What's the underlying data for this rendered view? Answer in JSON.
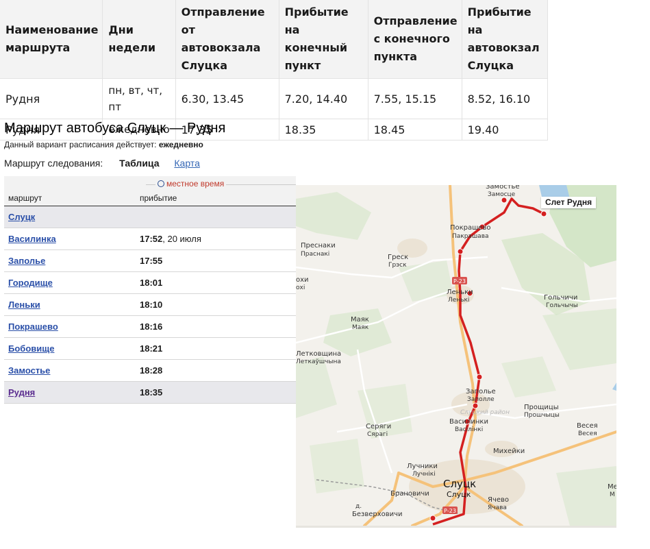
{
  "schedule": {
    "headers": [
      "Наименование маршрута",
      "Дни недели",
      "Отправление от автовокзала Слуцка",
      "Прибытие на конечный пункт",
      "Отправление с конечного пункта",
      "Прибытие на автовокзал Слуцка"
    ],
    "rows": [
      [
        "Рудня",
        "пн, вт, чт, пт",
        "6.30, 13.45",
        "7.20, 14.40",
        "7.55, 15.15",
        "8.52, 16.10"
      ],
      [
        "Рудня",
        "ежедневно",
        "17.35",
        "18.35",
        "18.45",
        "19.40"
      ]
    ]
  },
  "route": {
    "title": "Маршрут автобуса Слуцк — Рудня",
    "validity_prefix": "Данный вариант расписания действует:",
    "validity_value": "ежедневно",
    "view_label": "Маршрут следования:",
    "view_active": "Таблица",
    "view_link": "Карта"
  },
  "stops_table": {
    "timezone": "местное время",
    "col_route": "маршрут",
    "col_arrival": "прибытие",
    "stops": [
      {
        "name": "Слуцк",
        "time": "",
        "date": ""
      },
      {
        "name": "Василинка",
        "time": "17:52",
        "date": ", 20 июля"
      },
      {
        "name": "Заполье",
        "time": "17:55",
        "date": ""
      },
      {
        "name": "Городище",
        "time": "18:01",
        "date": ""
      },
      {
        "name": "Леньки",
        "time": "18:10",
        "date": ""
      },
      {
        "name": "Покрашево",
        "time": "18:16",
        "date": ""
      },
      {
        "name": "Бобовище",
        "time": "18:21",
        "date": ""
      },
      {
        "name": "Замостье",
        "time": "18:28",
        "date": ""
      },
      {
        "name": "Рудня",
        "time": "18:35",
        "date": ""
      }
    ]
  },
  "map": {
    "tooltip": "Слет Рудня",
    "road_badge": "Р-23",
    "labels": {
      "zamostye": "Замостье",
      "zamostye_by": "Замосце",
      "pokrashevo": "Покрашево",
      "pokrashevo_by": "Пакрашава",
      "presnaki": "Преснаки",
      "presnaki_by": "Праснакі",
      "gresk": "Греск",
      "gresk_by": "Грэск",
      "lenki": "Леньки",
      "lenki_by": "Ленькі",
      "golchichi": "Гольчичи",
      "golchichi_by": "Гольчычы",
      "mayak": "Маяк",
      "mayak_by": "Маяк",
      "letkovshchina": "Летковщина",
      "letkovshchina_by": "Леткаўшчына",
      "zapolye": "Заполье",
      "zapolye_by": "Заполле",
      "district": "Слуцкий район",
      "proshchitsy": "Прощицы",
      "proshchitsy_by": "Прошчыцы",
      "vesya": "Весея",
      "vesya_by": "Весея",
      "vasilinki": "Василинки",
      "vasilinki_by": "Васілінкі",
      "seryagi": "Серяги",
      "seryagi_by": "Сярагі",
      "mikheyki": "Михейки",
      "luchniki": "Лучники",
      "luchniki_by": "Лучнікі",
      "slutsk": "Слуцк",
      "slutsk_by": "Слуцк",
      "branovichi": "Брановичи",
      "yachevo": "Ячево",
      "yachevo_by": "Ячава",
      "bezverkhovichi_prefix": "д.",
      "bezverkhovichi": "Безверховичи",
      "edge_left": "охи",
      "edge_left_by": "охі",
      "edge_right": "Ме",
      "edge_right_by": "М"
    },
    "colors": {
      "route": "#d42020",
      "road_major": "#f5c27a",
      "forest": "#d4e6c8",
      "water": "#a9cde8",
      "town": "#ebe3d5"
    }
  }
}
